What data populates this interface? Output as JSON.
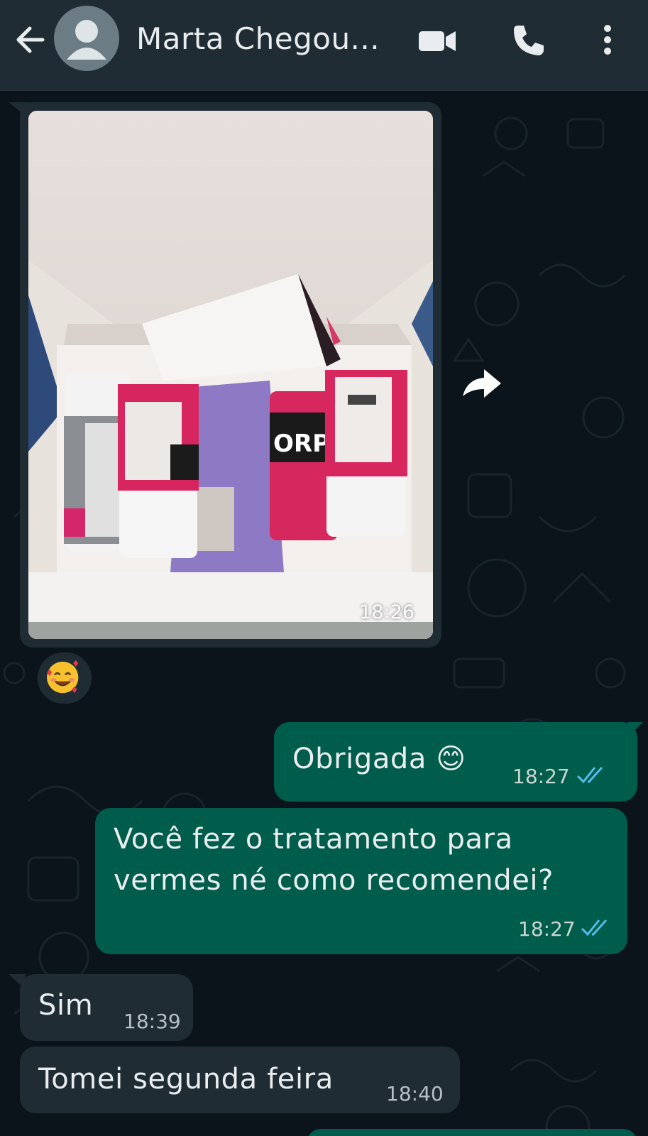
{
  "header": {
    "contact_name": "Marta Chegou...",
    "back_icon": "arrow-left-icon",
    "avatar_icon": "person-icon",
    "video_icon": "video-camera-icon",
    "call_icon": "phone-icon",
    "menu_icon": "more-vertical-icon"
  },
  "messages": [
    {
      "type": "image",
      "direction": "incoming",
      "time": "18:26",
      "reaction": "🥰",
      "forward_icon": "forward-arrow-icon"
    },
    {
      "type": "text",
      "direction": "outgoing",
      "text": "Obrigada 😊",
      "time": "18:27",
      "status": "read"
    },
    {
      "type": "text",
      "direction": "outgoing",
      "text_line1": "Você fez o tratamento para",
      "text_line2": "vermes né como recomendei?",
      "time": "18:27",
      "status": "read"
    },
    {
      "type": "text",
      "direction": "incoming",
      "text": "Sim",
      "time": "18:39"
    },
    {
      "type": "text",
      "direction": "incoming",
      "text": "Tomei segunda feira",
      "time": "18:40"
    }
  ],
  "colors": {
    "background": "#0b141a",
    "header": "#1f2c34",
    "incoming_bubble": "#1f2c34",
    "outgoing_bubble": "#005c4b",
    "read_ticks": "#53bdeb"
  }
}
